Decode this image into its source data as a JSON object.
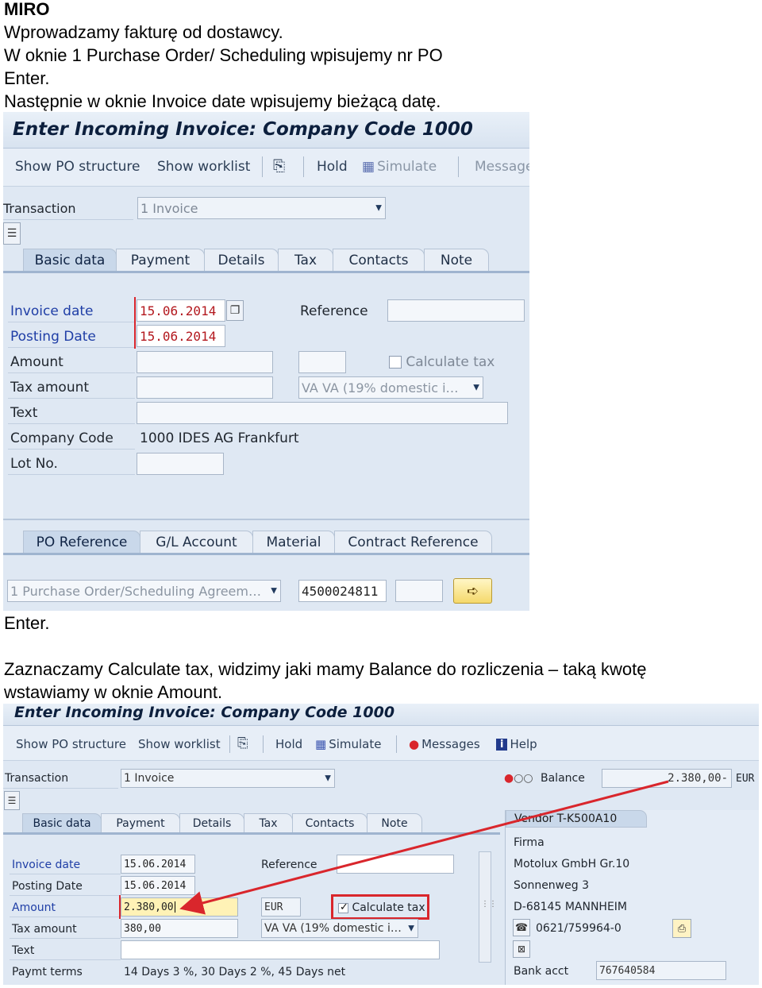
{
  "document": {
    "heading": "MIRO",
    "line1": "Wprowadzamy fakturę od dostawcy.",
    "line2": "W oknie 1 Purchase Order/ Scheduling wpisujemy nr PO",
    "line3": "Enter.",
    "line4": "Następnie w oknie Invoice date wpisujemy bieżącą datę.",
    "line5": "Enter.",
    "line6": "Zaznaczamy Calculate tax, widzimy jaki mamy Balance do rozliczenia – taką kwotę",
    "line7": "wstawiamy w oknie Amount."
  },
  "screen1": {
    "title": "Enter Incoming Invoice: Company Code 1000",
    "toolbar": {
      "show_po": "Show PO structure",
      "worklist": "Show worklist",
      "hold": "Hold",
      "simulate": "Simulate",
      "messages": "Message"
    },
    "transaction_label": "Transaction",
    "transaction_value": "1 Invoice",
    "tabs": [
      "Basic data",
      "Payment",
      "Details",
      "Tax",
      "Contacts",
      "Note"
    ],
    "labels": {
      "invoice_date": "Invoice date",
      "posting_date": "Posting Date",
      "amount": "Amount",
      "tax_amount": "Tax amount",
      "text": "Text",
      "company_code": "Company Code",
      "lot_no": "Lot No.",
      "reference": "Reference",
      "calculate_tax": "Calculate tax"
    },
    "values": {
      "invoice_date": "15.06.2014",
      "posting_date": "15.06.2014",
      "tax_code": "VA VA (19% domestic i…",
      "company_code": "1000 IDES AG Frankfurt"
    },
    "ref_tabs": [
      "PO Reference",
      "G/L Account",
      "Material",
      "Contract Reference"
    ],
    "po_type": "1 Purchase Order/Scheduling Agreem…",
    "po_number": "4500024811"
  },
  "screen2": {
    "title": "Enter Incoming Invoice: Company Code 1000",
    "toolbar": {
      "show_po": "Show PO structure",
      "worklist": "Show worklist",
      "hold": "Hold",
      "simulate": "Simulate",
      "messages": "Messages",
      "help": "Help"
    },
    "transaction_label": "Transaction",
    "transaction_value": "1 Invoice",
    "balance_label": "Balance",
    "balance_value": "2.380,00-",
    "balance_currency": "EUR",
    "tabs": [
      "Basic data",
      "Payment",
      "Details",
      "Tax",
      "Contacts",
      "Note"
    ],
    "labels": {
      "invoice_date": "Invoice date",
      "posting_date": "Posting Date",
      "amount": "Amount",
      "tax_amount": "Tax amount",
      "text": "Text",
      "paymt_terms": "Paymt terms",
      "reference": "Reference",
      "calculate_tax": "Calculate tax"
    },
    "values": {
      "invoice_date": "15.06.2014",
      "posting_date": "15.06.2014",
      "amount": "2.380,00",
      "currency": "EUR",
      "tax_amount": "380,00",
      "tax_code": "VA VA (19% domestic i…",
      "paymt_terms": "14 Days 3 %, 30 Days 2 %, 45 Days net"
    },
    "vendor": {
      "title": "Vendor T-K500A10",
      "firma": "Firma",
      "name": "Motolux GmbH Gr.10",
      "street": "Sonnenweg 3",
      "city": "D-68145 MANNHEIM",
      "phone": "0621/759964-0",
      "bank_label": "Bank acct",
      "bank_value": "767640584"
    }
  },
  "colors": {
    "highlight_box": "#d9262c",
    "arrow": "#d9262c",
    "required_label": "#1f3ea6"
  }
}
